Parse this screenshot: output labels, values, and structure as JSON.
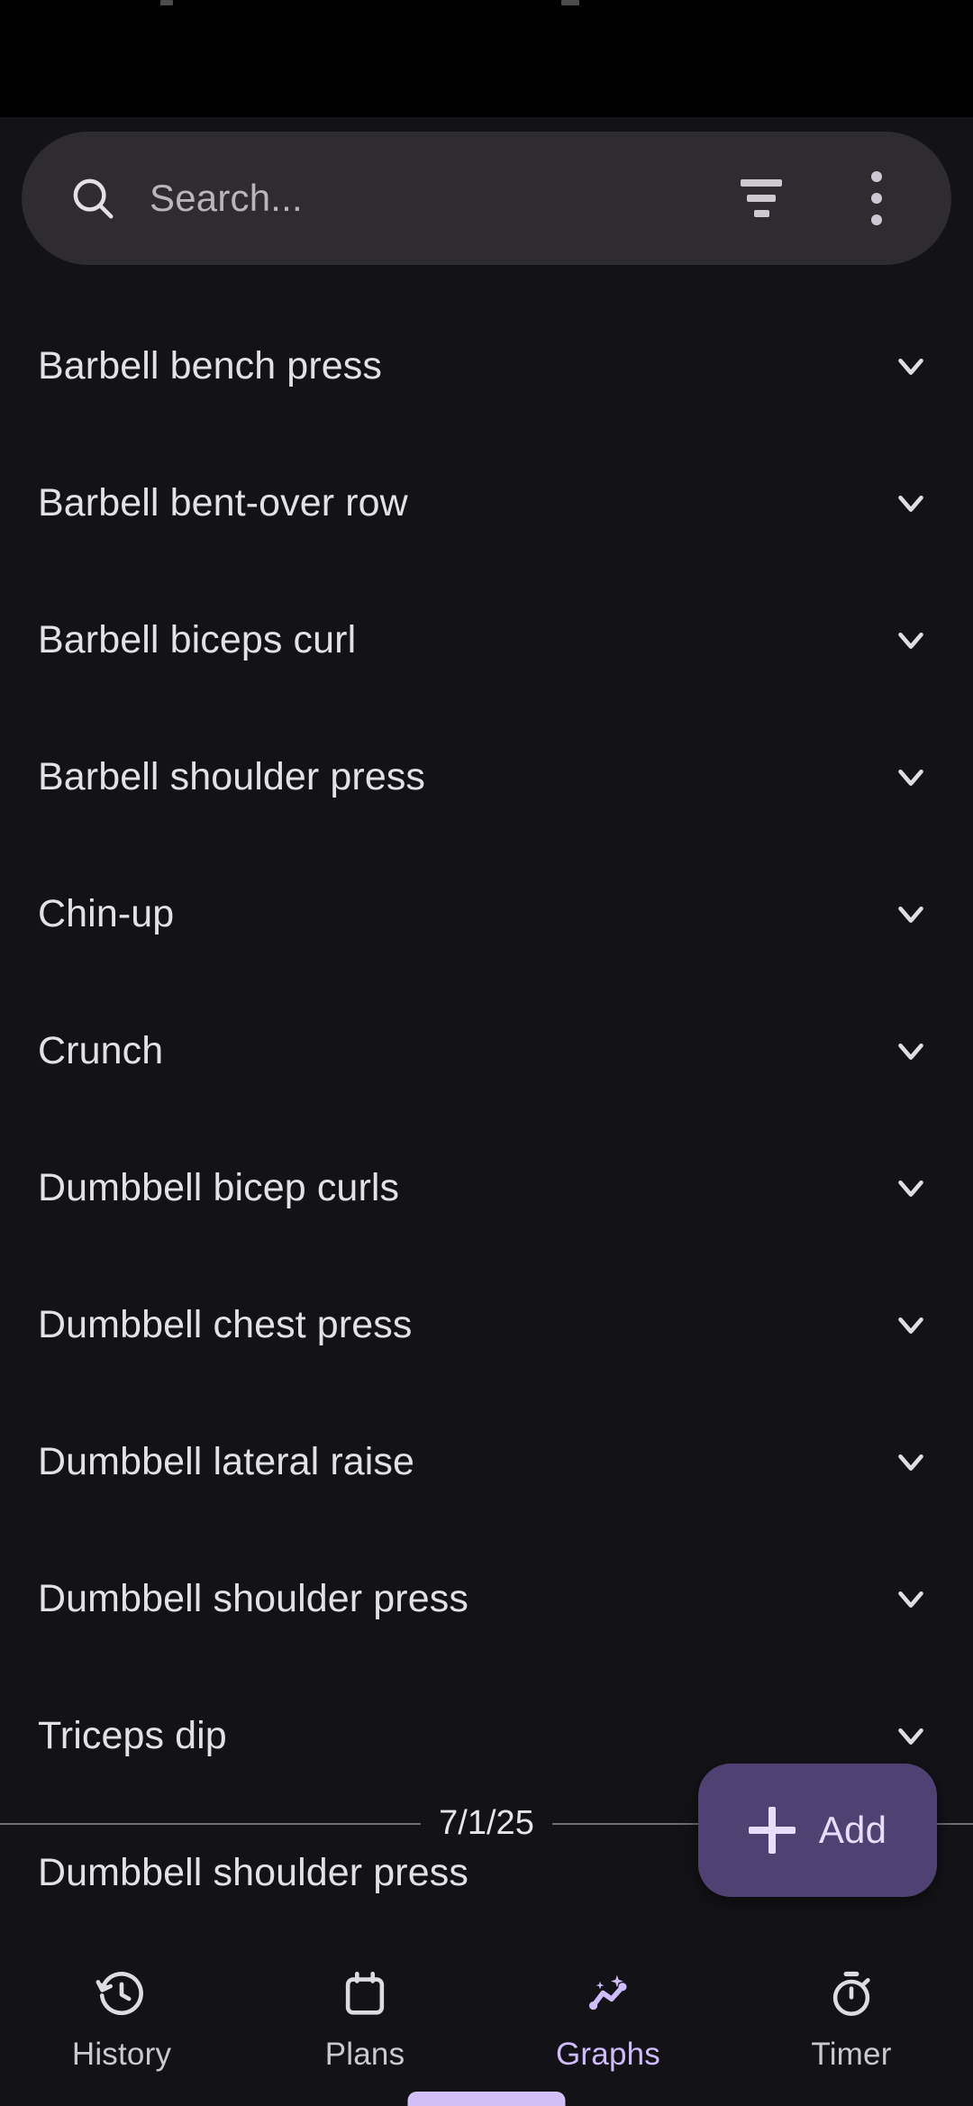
{
  "app": {
    "background_color": "#131216",
    "accent_color": "#cfbcfc",
    "fab_color": "#4f4272",
    "search_bar_color": "#2e2b31"
  },
  "search": {
    "placeholder": "Search...",
    "value": "",
    "search_icon": "search-icon",
    "filter_icon": "filter-icon",
    "overflow_icon": "more-vertical-icon"
  },
  "exercise_list": {
    "items": [
      {
        "name": "Barbell bench press",
        "expand_icon": "chevron-down-icon"
      },
      {
        "name": "Barbell bent-over row",
        "expand_icon": "chevron-down-icon"
      },
      {
        "name": "Barbell biceps curl",
        "expand_icon": "chevron-down-icon"
      },
      {
        "name": "Barbell shoulder press",
        "expand_icon": "chevron-down-icon"
      },
      {
        "name": "Chin-up",
        "expand_icon": "chevron-down-icon"
      },
      {
        "name": "Crunch",
        "expand_icon": "chevron-down-icon"
      },
      {
        "name": "Dumbbell bicep curls",
        "expand_icon": "chevron-down-icon"
      },
      {
        "name": "Dumbbell chest press",
        "expand_icon": "chevron-down-icon"
      },
      {
        "name": "Dumbbell lateral raise",
        "expand_icon": "chevron-down-icon"
      },
      {
        "name": "Dumbbell shoulder press",
        "expand_icon": "chevron-down-icon"
      },
      {
        "name": "Triceps dip",
        "expand_icon": "chevron-down-icon"
      },
      {
        "name": "Dumbbell shoulder press",
        "expand_icon": "chevron-down-icon"
      }
    ]
  },
  "date_divider": {
    "date": "7/1/25"
  },
  "fab": {
    "label": "Add",
    "icon": "plus-icon"
  },
  "bottom_nav": {
    "items": [
      {
        "label": "History",
        "icon": "history-clock-icon",
        "active": false
      },
      {
        "label": "Plans",
        "icon": "calendar-icon",
        "active": false
      },
      {
        "label": "Graphs",
        "icon": "line-chart-sparkle-icon",
        "active": true
      },
      {
        "label": "Timer",
        "icon": "stopwatch-icon",
        "active": false
      }
    ]
  }
}
